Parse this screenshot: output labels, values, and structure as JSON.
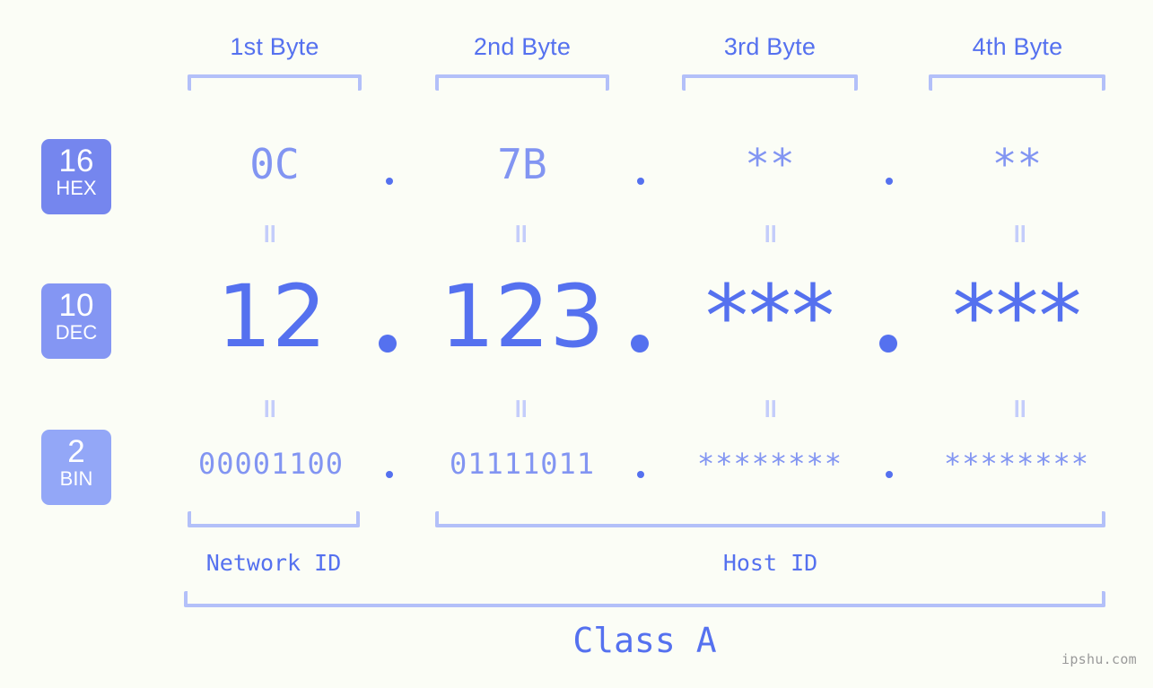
{
  "page": {
    "background_color": "#fbfdf6",
    "accent_color": "#5571ef",
    "accent_light_color": "#8295f2",
    "bracket_color": "#b3c0f9",
    "watermark": "ipshu.com"
  },
  "byte_headers": [
    {
      "label": "1st Byte"
    },
    {
      "label": "2nd Byte"
    },
    {
      "label": "3rd Byte"
    },
    {
      "label": "4th Byte"
    }
  ],
  "bases": [
    {
      "number": "16",
      "abbr": "HEX",
      "color": "#7586ee"
    },
    {
      "number": "10",
      "abbr": "DEC",
      "color": "#8496f3"
    },
    {
      "number": "2",
      "abbr": "BIN",
      "color": "#93a7f7"
    }
  ],
  "rows": {
    "hex": {
      "values": [
        "0C",
        "7B",
        "**",
        "**"
      ],
      "separator": "."
    },
    "dec": {
      "values": [
        "12",
        "123",
        "***",
        "***"
      ],
      "separator": "."
    },
    "bin": {
      "values": [
        "00001100",
        "01111011",
        "********",
        "********"
      ],
      "separator": "."
    }
  },
  "equals_marks": {
    "symbol": "=",
    "count_per_gap": 4
  },
  "segments": [
    {
      "label": "Network ID"
    },
    {
      "label": "Host ID"
    }
  ],
  "class": {
    "label": "Class A"
  }
}
